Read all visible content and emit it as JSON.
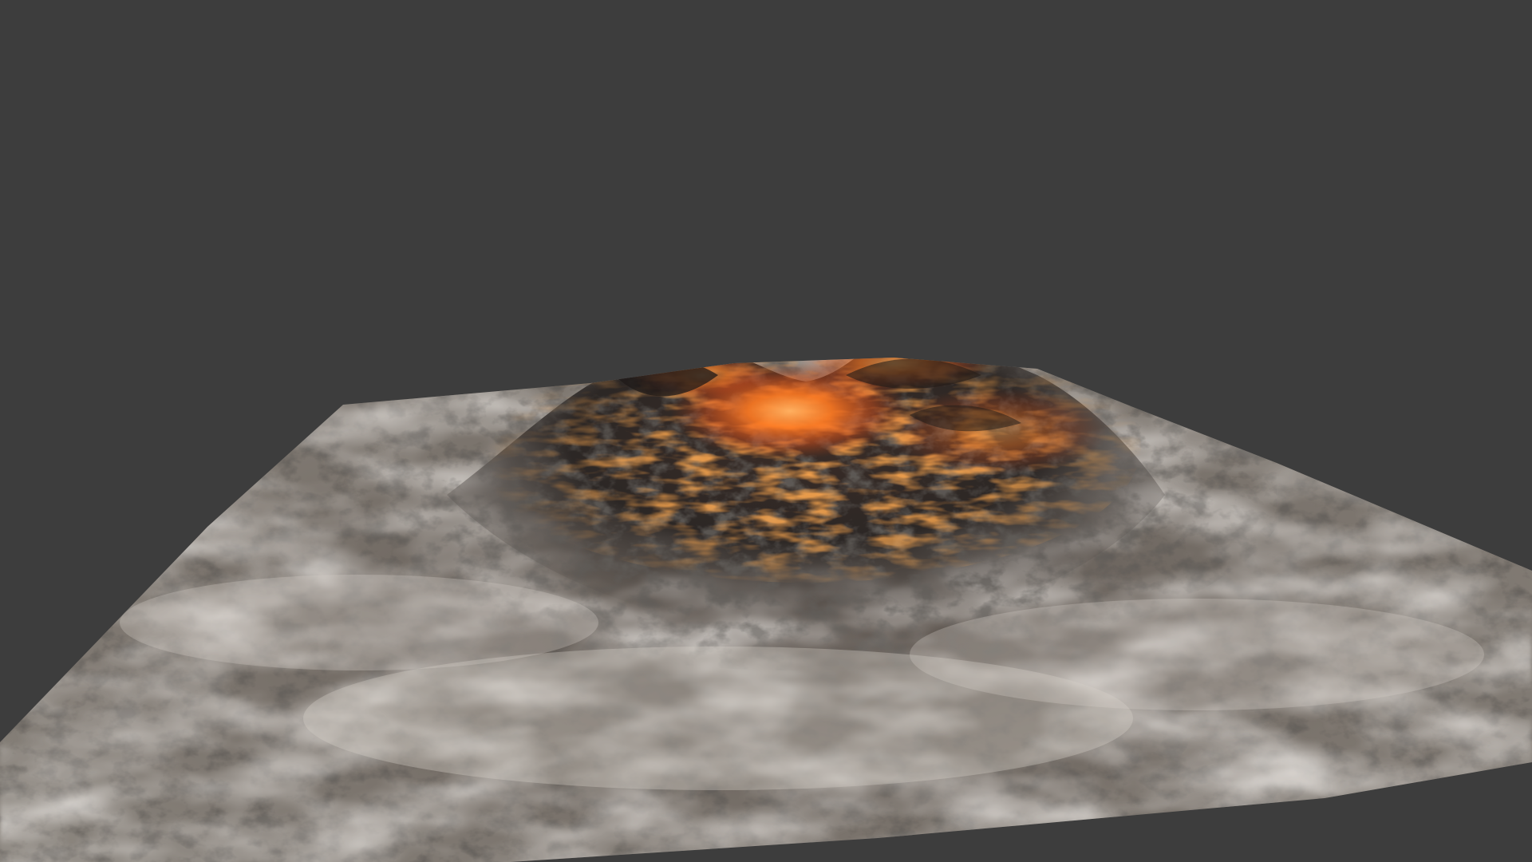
{
  "viewport": {
    "background_color": "#3d3d3d",
    "object": "volcano-terrain-mesh"
  },
  "terrain": {
    "base_color": "#8a847d",
    "fog_color": "#d8d2cb",
    "rock_color": "#2a2624",
    "lava_color": "#ff6a1a",
    "lava_glow_color": "#ffa040"
  }
}
